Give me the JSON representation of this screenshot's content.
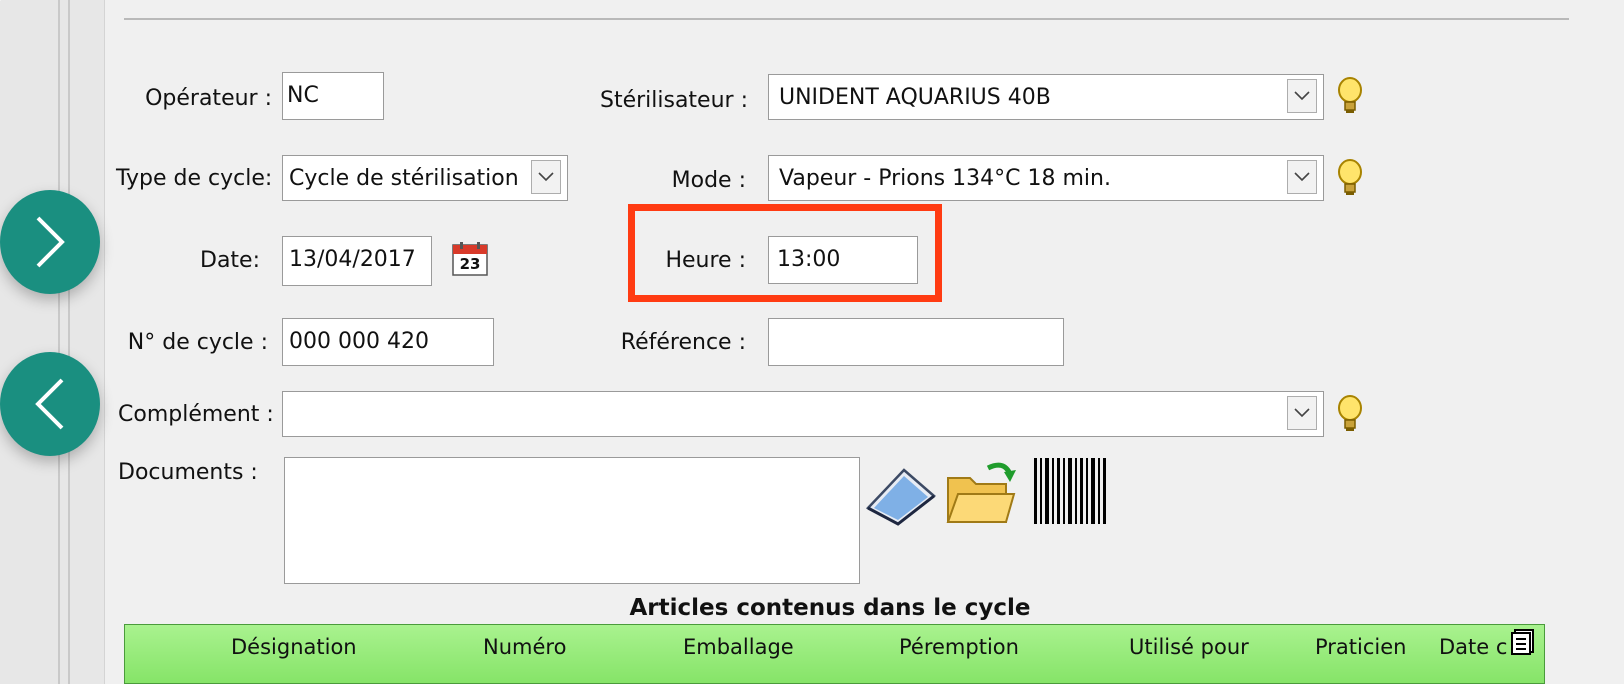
{
  "form": {
    "operateur_label": "Opérateur :",
    "operateur_value": "NC",
    "sterilisateur_label": "Stérilisateur :",
    "sterilisateur_value": "UNIDENT AQUARIUS 40B",
    "type_cycle_label": "Type de cycle:",
    "type_cycle_value": "Cycle de stérilisation",
    "mode_label": "Mode :",
    "mode_value": "Vapeur - Prions 134°C 18 min.",
    "date_label": "Date:",
    "date_value": "13/04/2017",
    "calendar_day": "23",
    "heure_label": "Heure :",
    "heure_value": "13:00",
    "num_cycle_label": "N° de cycle :",
    "num_cycle_value": "000 000 420",
    "reference_label": "Référence :",
    "reference_value": "",
    "complement_label": "Complément :",
    "complement_value": "",
    "documents_label": "Documents :"
  },
  "articles": {
    "title": "Articles contenus dans le cycle",
    "columns": [
      "Désignation",
      "Numéro",
      "Emballage",
      "Péremption",
      "Utilisé pour",
      "Praticien",
      "Date c"
    ]
  },
  "colors": {
    "accent_teal": "#1a8f80",
    "highlight": "#ff3b12",
    "grid_header_green": "#98ea7c"
  },
  "icons": [
    "chevron-right-icon",
    "chevron-left-icon",
    "dropdown-arrow-icon",
    "lightbulb-icon",
    "calendar-icon",
    "scanner-icon",
    "folder-open-icon",
    "barcode-icon",
    "column-chooser-icon"
  ]
}
